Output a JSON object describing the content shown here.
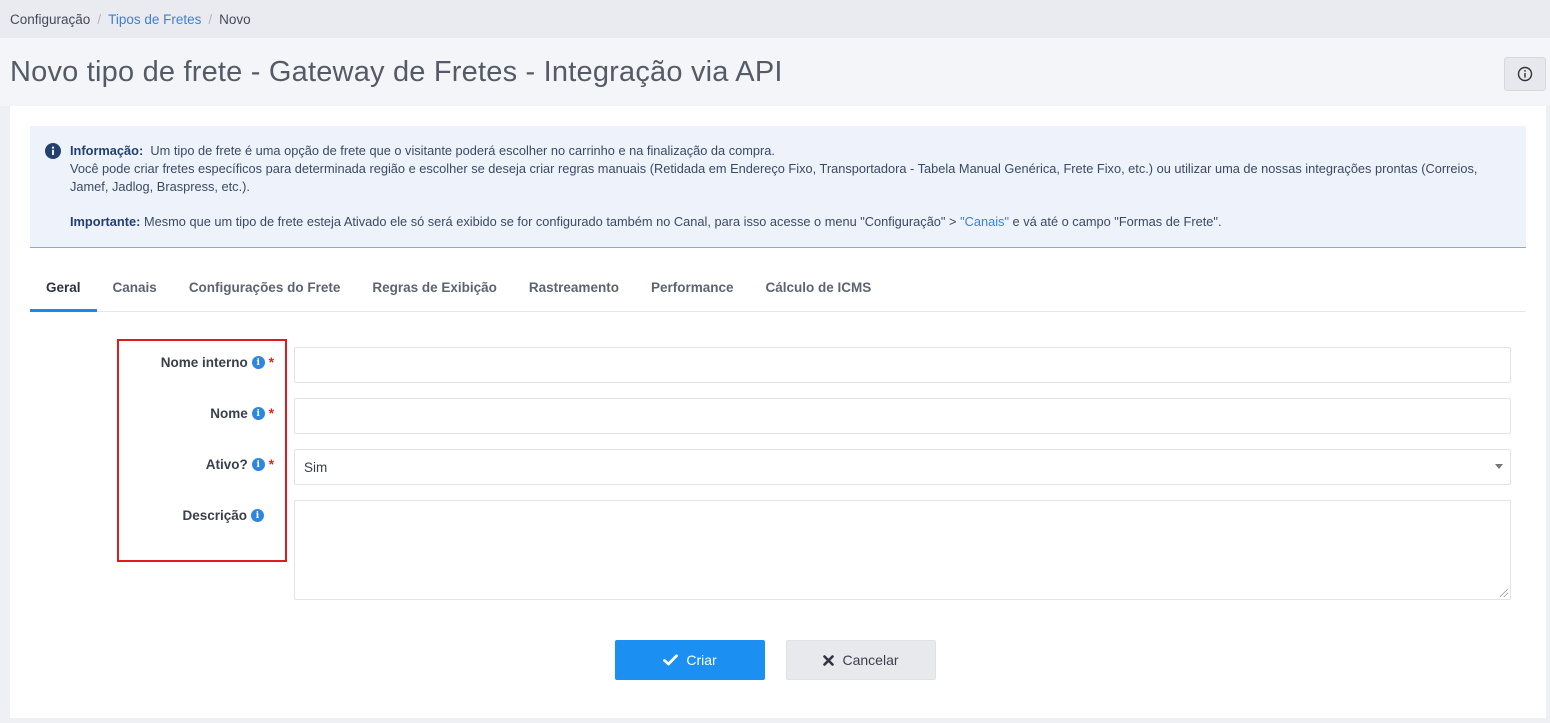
{
  "breadcrumb": {
    "items": [
      "Configuração",
      "Tipos de Fretes",
      "Novo"
    ],
    "separator": "/"
  },
  "page": {
    "title": "Novo tipo de frete - Gateway de Fretes - Integração via API",
    "help_icon": "info-circle-icon"
  },
  "info": {
    "label": "Informação:",
    "line1": "Um tipo de frete é uma opção de frete que o visitante poderá escolher no carrinho e na finalização da compra.",
    "line2": "Você pode criar fretes específicos para determinada região e escolher se deseja criar regras manuais (Retidada em Endereço Fixo, Transportadora - Tabela Manual Genérica, Frete Fixo, etc.) ou utilizar uma de nossas integrações prontas (Correios, Jamef, Jadlog, Braspress, etc.).",
    "important_label": "Importante:",
    "important_text_before": "Mesmo que um tipo de frete esteja Ativado ele só será exibido se for configurado também no Canal, para isso acesse o menu \"Configuração\" >",
    "important_link": "\"Canais\"",
    "important_text_after": "e vá até o campo \"Formas de Frete\"."
  },
  "tabs": [
    {
      "label": "Geral",
      "active": true
    },
    {
      "label": "Canais"
    },
    {
      "label": "Configurações do Frete"
    },
    {
      "label": "Regras de Exibição"
    },
    {
      "label": "Rastreamento"
    },
    {
      "label": "Performance"
    },
    {
      "label": "Cálculo de ICMS"
    }
  ],
  "form": {
    "internal_name": {
      "label": "Nome interno",
      "required_mark": "*",
      "value": ""
    },
    "name": {
      "label": "Nome",
      "required_mark": "*",
      "value": ""
    },
    "active": {
      "label": "Ativo?",
      "required_mark": "*",
      "value": "Sim"
    },
    "description": {
      "label": "Descrição",
      "value": ""
    },
    "info_glyph": "i"
  },
  "actions": {
    "create_label": "Criar",
    "cancel_label": "Cancelar"
  },
  "colors": {
    "primary": "#1b8ff2",
    "link": "#3d7fd6",
    "required": "#e02020",
    "highlight_box": "#e01b1b"
  }
}
